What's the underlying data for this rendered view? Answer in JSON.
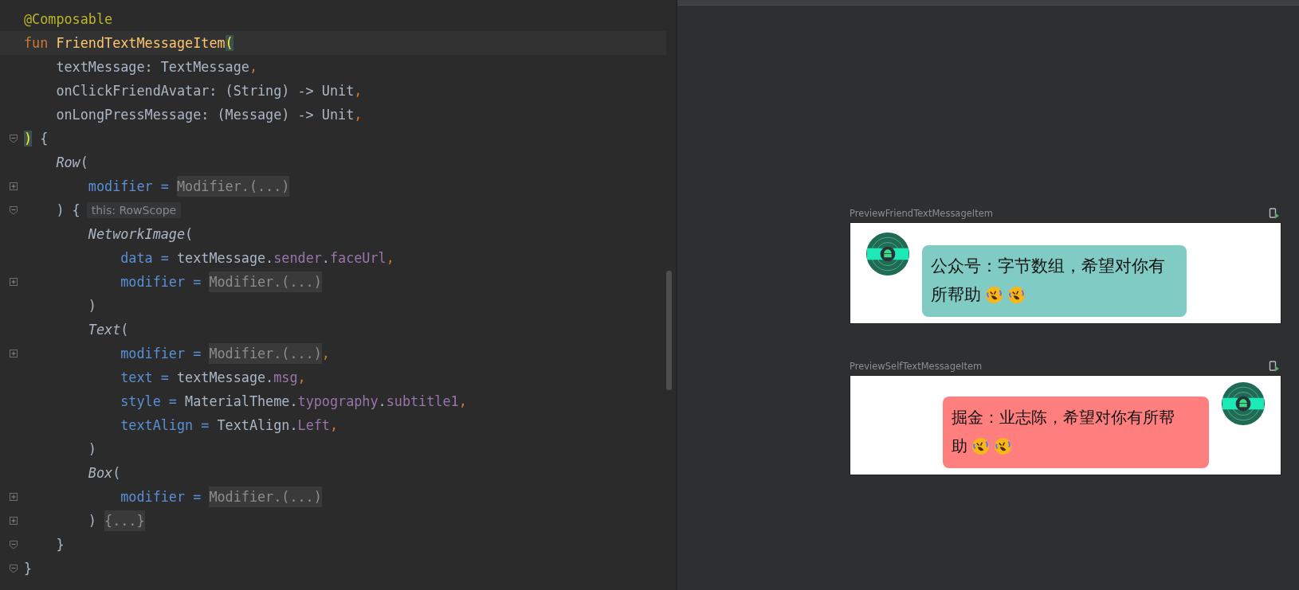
{
  "editor": {
    "lines": [
      {
        "tokens": [
          {
            "kind": "ann",
            "text": "@Composable"
          }
        ]
      },
      {
        "current": true,
        "tokens": [
          {
            "kind": "kw",
            "text": "fun "
          },
          {
            "kind": "fn",
            "text": "FriendTextMessageItem"
          },
          {
            "kind": "match",
            "text": "("
          }
        ]
      },
      {
        "tokens": [
          {
            "kind": "plain",
            "text": "    textMessage: TextMessage"
          },
          {
            "kind": "kw",
            "text": ","
          }
        ]
      },
      {
        "tokens": [
          {
            "kind": "plain",
            "text": "    onClickFriendAvatar: (String) -> Unit"
          },
          {
            "kind": "kw",
            "text": ","
          }
        ]
      },
      {
        "tokens": [
          {
            "kind": "plain",
            "text": "    onLongPressMessage: (Message) -> Unit"
          },
          {
            "kind": "kw",
            "text": ","
          }
        ]
      },
      {
        "fold": {
          "folded": false
        },
        "tokens": [
          {
            "kind": "match",
            "text": ")"
          },
          {
            "kind": "plain",
            "text": " {"
          }
        ]
      },
      {
        "tokens": [
          {
            "kind": "call",
            "text": "    Row"
          },
          {
            "kind": "plain",
            "text": "("
          }
        ]
      },
      {
        "fold": {
          "folded": true
        },
        "tokens": [
          {
            "kind": "named",
            "text": "        modifier = "
          },
          {
            "kind": "fold",
            "text": "Modifier.(...)"
          }
        ]
      },
      {
        "fold": {
          "folded": false
        },
        "tokens": [
          {
            "kind": "plain",
            "text": "    ) {"
          },
          {
            "kind": "hint",
            "text": "this: RowScope"
          }
        ]
      },
      {
        "tokens": [
          {
            "kind": "call",
            "text": "        NetworkImage"
          },
          {
            "kind": "plain",
            "text": "("
          }
        ]
      },
      {
        "tokens": [
          {
            "kind": "named",
            "text": "            data = "
          },
          {
            "kind": "plain",
            "text": "textMessage."
          },
          {
            "kind": "prop",
            "text": "sender"
          },
          {
            "kind": "plain",
            "text": "."
          },
          {
            "kind": "prop",
            "text": "faceUrl"
          },
          {
            "kind": "kw",
            "text": ","
          }
        ]
      },
      {
        "fold": {
          "folded": true
        },
        "tokens": [
          {
            "kind": "named",
            "text": "            modifier = "
          },
          {
            "kind": "fold",
            "text": "Modifier.(...)"
          }
        ]
      },
      {
        "tokens": [
          {
            "kind": "plain",
            "text": "        )"
          }
        ]
      },
      {
        "tokens": [
          {
            "kind": "call",
            "text": "        Text"
          },
          {
            "kind": "plain",
            "text": "("
          }
        ]
      },
      {
        "fold": {
          "folded": true
        },
        "tokens": [
          {
            "kind": "named",
            "text": "            modifier = "
          },
          {
            "kind": "fold",
            "text": "Modifier.(...)"
          },
          {
            "kind": "kw",
            "text": ","
          }
        ]
      },
      {
        "tokens": [
          {
            "kind": "named",
            "text": "            text = "
          },
          {
            "kind": "plain",
            "text": "textMessage."
          },
          {
            "kind": "prop",
            "text": "msg"
          },
          {
            "kind": "kw",
            "text": ","
          }
        ]
      },
      {
        "tokens": [
          {
            "kind": "named",
            "text": "            style = "
          },
          {
            "kind": "plain",
            "text": "MaterialTheme."
          },
          {
            "kind": "prop",
            "text": "typography"
          },
          {
            "kind": "plain",
            "text": "."
          },
          {
            "kind": "prop",
            "text": "subtitle1"
          },
          {
            "kind": "kw",
            "text": ","
          }
        ]
      },
      {
        "tokens": [
          {
            "kind": "named",
            "text": "            textAlign = "
          },
          {
            "kind": "plain",
            "text": "TextAlign."
          },
          {
            "kind": "prop",
            "text": "Left"
          },
          {
            "kind": "kw",
            "text": ","
          }
        ]
      },
      {
        "tokens": [
          {
            "kind": "plain",
            "text": "        )"
          }
        ]
      },
      {
        "tokens": [
          {
            "kind": "call",
            "text": "        Box"
          },
          {
            "kind": "plain",
            "text": "("
          }
        ]
      },
      {
        "fold": {
          "folded": true
        },
        "tokens": [
          {
            "kind": "named",
            "text": "            modifier = "
          },
          {
            "kind": "fold",
            "text": "Modifier.(...)"
          }
        ]
      },
      {
        "fold": {
          "folded": true
        },
        "tokens": [
          {
            "kind": "plain",
            "text": "        ) "
          },
          {
            "kind": "fold",
            "text": "{...}"
          }
        ]
      },
      {
        "fold": {
          "folded": false
        },
        "tokens": [
          {
            "kind": "plain",
            "text": "    }"
          }
        ]
      },
      {
        "fold": {
          "folded": false
        },
        "tokens": [
          {
            "kind": "plain",
            "text": "}"
          }
        ]
      }
    ]
  },
  "previews": [
    {
      "label": "PreviewFriendTextMessageItem",
      "kind": "friend",
      "color": "#80cbc4",
      "text_lines": [
        "公众号：字节数组，希望对你有",
        "所帮助"
      ],
      "emojis": [
        {
          "kind": "rofl"
        },
        {
          "kind": "rofl"
        }
      ]
    },
    {
      "label": "PreviewSelfTextMessageItem",
      "kind": "self",
      "color": "#ff7f7f",
      "text_lines": [
        "掘金：业志陈，希望对你有所帮",
        "助"
      ],
      "emojis": [
        {
          "kind": "rofl"
        },
        {
          "kind": "rofl"
        }
      ]
    }
  ]
}
